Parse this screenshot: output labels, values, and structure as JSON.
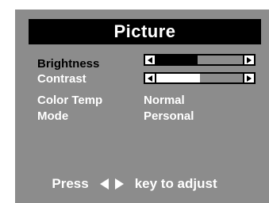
{
  "menu": {
    "title": "Picture",
    "items": [
      {
        "label": "Brightness",
        "type": "slider",
        "level": 0.48,
        "selected": true,
        "fill_color": "#000000",
        "empty_color": "#8c8c8c"
      },
      {
        "label": "Contrast",
        "type": "slider",
        "level": 0.5,
        "selected": false,
        "fill_color": "#ffffff",
        "empty_color": "#8c8c8c"
      },
      {
        "label": "Color Temp",
        "type": "value",
        "value": "Normal",
        "selected": false
      },
      {
        "label": "Mode",
        "type": "value",
        "value": "Personal",
        "selected": false
      }
    ]
  },
  "footer": {
    "press": "Press",
    "left_icon": "triangle-left-icon",
    "right_icon": "triangle-right-icon",
    "instruction": "key to adjust"
  },
  "colors": {
    "panel": "#8c8c8c",
    "title_bar": "#000000",
    "text": "#ffffff",
    "selected_text": "#000000"
  }
}
